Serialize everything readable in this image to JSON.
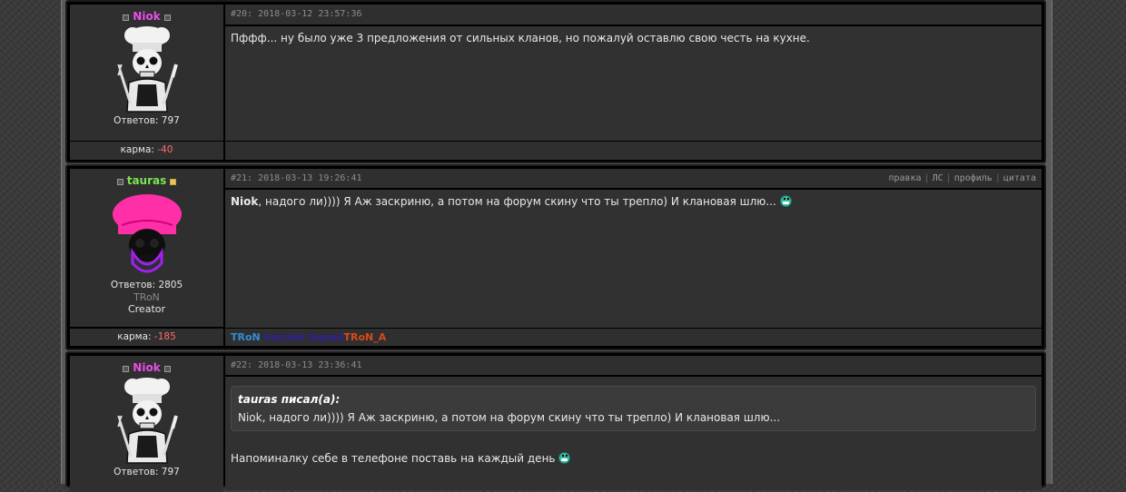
{
  "posts": [
    {
      "username": "Niok",
      "username_color": "#e84de8",
      "replies": "Ответов: 797",
      "karma_label": "карма:",
      "karma_value": "-40",
      "header": "#20: 2018-03-12 23:57:36",
      "body": "Пффф... ну было уже 3 предложения от сильных кланов, но пожалуй оставлю свою честь на кухне.",
      "avatar_icon": "chef-skull-icon"
    },
    {
      "username": "tauras",
      "username_color": "#7be64d",
      "replies": "Ответов: 2805",
      "clan": "TRoN",
      "role": "Creator",
      "karma_label": "карма:",
      "karma_value": "-185",
      "header": "#21: 2018-03-13 19:26:41",
      "actions": [
        "правка",
        "ЛС",
        "профиль",
        "цитата"
      ],
      "body_mention": "Niok",
      "body_text": ", надого ли)))) Я Аж заскриню, а потом на форум скину что ты трепло) И клановая шлю...",
      "signature": [
        {
          "text": "TRoN ",
          "color": "#2f8fd8"
        },
        {
          "text": "Suicide Squad",
          "color": "#2d1fa0"
        },
        {
          "text": "TRoN_A",
          "color": "#d84a1a"
        }
      ],
      "avatar_icon": "pink-skull-icon"
    },
    {
      "username": "Niok",
      "username_color": "#e84de8",
      "replies": "Ответов: 797",
      "header": "#22: 2018-03-13 23:36:41",
      "quote_header": "tauras писал(а):",
      "quote_text": "Niok, надого ли)))) Я Аж заскриню, а потом на форум скину что ты трепло) И клановая шлю...",
      "body": "Напоминалку себе в телефоне поставь на каждый день",
      "avatar_icon": "chef-skull-icon"
    }
  ]
}
